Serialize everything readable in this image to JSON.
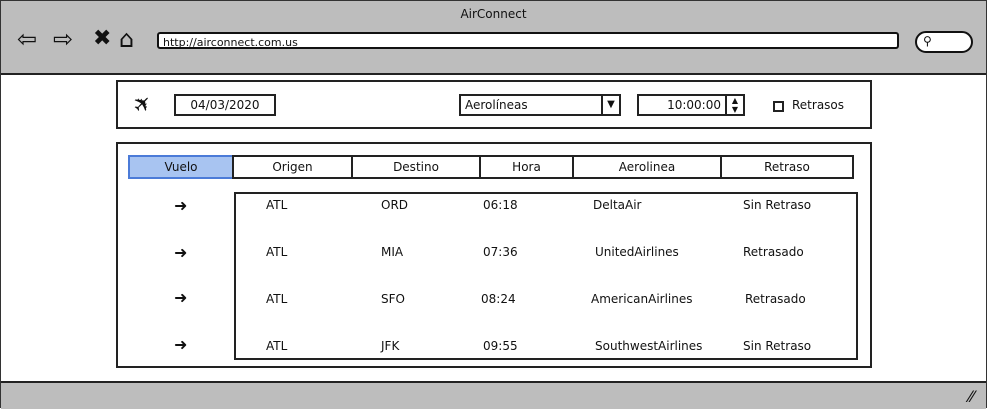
{
  "window": {
    "title": "AirConnect",
    "url": "http://airconnect.com.us"
  },
  "filters": {
    "date": "04/03/2020",
    "airline_select": "Aerolíneas",
    "time": "10:00:00",
    "delays_label": "Retrasos"
  },
  "table": {
    "headers": [
      "Vuelo",
      "Origen",
      "Destino",
      "Hora",
      "Aerolinea",
      "Retraso"
    ],
    "rows": [
      {
        "origin": "ATL",
        "destination": "ORD",
        "time": "06:18",
        "airline": "DeltaAir",
        "delay": "Sin Retraso"
      },
      {
        "origin": "ATL",
        "destination": "MIA",
        "time": "07:36",
        "airline": "UnitedAirlines",
        "delay": "Retrasado"
      },
      {
        "origin": "ATL",
        "destination": "SFO",
        "time": "08:24",
        "airline": "AmericanAirlines",
        "delay": "Retrasado"
      },
      {
        "origin": "ATL",
        "destination": "JFK",
        "time": "09:55",
        "airline": "SouthwestAirlines",
        "delay": "Sin Retraso"
      }
    ]
  },
  "icons": {
    "back": "back-arrow-icon",
    "forward": "forward-arrow-icon",
    "close": "close-icon",
    "home": "home-icon",
    "search": "search-icon",
    "plane": "plane-icon",
    "row_arrow": "right-arrow-icon"
  },
  "colors": {
    "chrome": "#bdbdbd",
    "active_header": "#a8c4f1"
  }
}
